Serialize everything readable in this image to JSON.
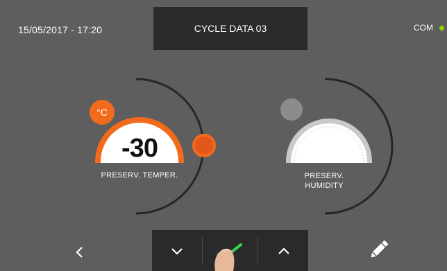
{
  "header": {
    "datetime": "15/05/2017 - 17:20",
    "title": "CYCLE DATA 03",
    "status": "COM"
  },
  "temperature_dial": {
    "value": "-30",
    "unit": "°C",
    "label": "PRESERV. TEMPER."
  },
  "humidity_dial": {
    "label_line1": "PRESERV.",
    "label_line2": "HUMIDITY"
  },
  "colors": {
    "accent": "#f26b1d",
    "status_ok": "#8fd400",
    "confirm_check": "#39d353",
    "background": "#5e5e5e",
    "panel": "#2a2a2a"
  },
  "icons": {
    "back": "chevron-left-icon",
    "down": "chevron-down-icon",
    "confirm": "check-icon",
    "up": "chevron-up-icon",
    "edit": "pencil-icon"
  }
}
